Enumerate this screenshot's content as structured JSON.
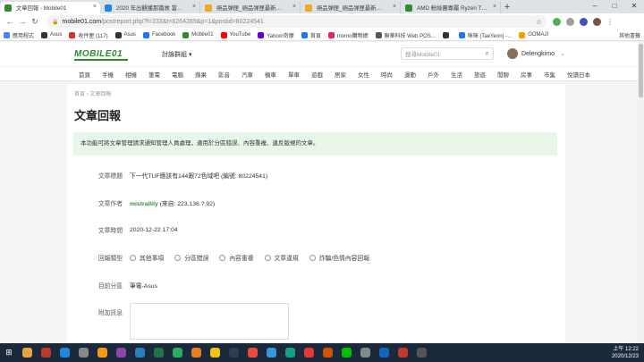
{
  "browser": {
    "tabs": [
      {
        "title": "文章回報 - Mobile01",
        "active": true,
        "color": "#2e8b2e"
      },
      {
        "title": "2020 年出觀播那篇故 當方網站",
        "active": false,
        "color": "#1e88e5"
      },
      {
        "title": "絕品弹匣_絕品弹匣最新電节_发",
        "active": false,
        "color": "#f5a623"
      },
      {
        "title": "絕品弹匣_絕品弹匣最新電节_絕品弹匣小说",
        "active": false,
        "color": "#f5a623"
      },
      {
        "title": "AMD 粉絲團專屬 Ryzen Thread",
        "active": false,
        "color": "#2e8b2e"
      }
    ],
    "url_host": "mobile01.com",
    "url_path": "/postreport.php?f=233&t=6264289&p=1&postid=80224541",
    "bookmarks": [
      {
        "label": "應用程式",
        "color": "#4285f4"
      },
      {
        "label": "Asus",
        "color": "#333"
      },
      {
        "label": "收件匣 (117)",
        "color": "#d93025"
      },
      {
        "label": "Asus",
        "color": "#333"
      },
      {
        "label": "Facebook",
        "color": "#1877f2"
      },
      {
        "label": "Mobile01",
        "color": "#2e8b2e"
      },
      {
        "label": "YouTube",
        "color": "#ff0000"
      },
      {
        "label": "Yahoo!奇摩",
        "color": "#6001d2"
      },
      {
        "label": "首頁",
        "color": "#1877f2"
      },
      {
        "label": "momo購物網",
        "color": "#e91e63"
      },
      {
        "label": "聯華科技 Web POS...",
        "color": "#555"
      },
      {
        "label": "",
        "color": "#333"
      },
      {
        "label": "咪咪 (TaeYeon) -...",
        "color": "#1877f2"
      },
      {
        "label": "GOMAJI",
        "color": "#f59e0b"
      }
    ],
    "other_bookmarks": "其他書籤"
  },
  "site": {
    "logo": "MOBILE01",
    "forum_menu": "討論群組 ▾",
    "search_placeholder": "搜尋Mobile01",
    "username": "Delengkimo",
    "categories": [
      "首頁",
      "手機",
      "相機",
      "筆電",
      "電腦",
      "蘋果",
      "影音",
      "汽車",
      "機車",
      "單車",
      "遊戲",
      "居家",
      "女性",
      "時尚",
      "運動",
      "戶外",
      "生活",
      "旅遊",
      "閒聊",
      "房事",
      "市集",
      "悅讀日本"
    ]
  },
  "page": {
    "breadcrumb": "首頁 › 文章回報",
    "title": "文章回報",
    "notice": "本功能可將文章管理請求通知管理人員處理，適用於分區錯誤、內容重複、違反版規的文章。",
    "fields": {
      "article_title_label": "文章標題",
      "article_title_value": "下一代TUF應該有144跟72色域吧 (編號: 80224541)",
      "author_label": "文章作者",
      "author_name": "mistrallily",
      "author_ip": " (來自: 223.136.?.92)",
      "time_label": "文章時間",
      "time_value": "2020-12-22 17:04",
      "report_type_label": "回報類型",
      "report_options": [
        "其他事項",
        "分區錯誤",
        "內容重複",
        "文章違規",
        "詐騙/色情內容回報"
      ],
      "section_label": "目前分區",
      "section_value": "筆電-Asus",
      "extra_label": "附加訊息"
    }
  },
  "taskbar": {
    "time": "上午 12:22",
    "date": "2020/12/23",
    "apps": [
      "#e8a33c",
      "#c0392b",
      "#1e88e5",
      "#888",
      "#f39c12",
      "#8e44ad",
      "#2980b9",
      "#217346",
      "#27ae60",
      "#e67e22",
      "#f1c40f",
      "#2c3e50",
      "#e74c3c",
      "#3498db",
      "#16a085",
      "#e53935",
      "#d35400",
      "#00c300",
      "#7f8c8d",
      "#1565c0",
      "#c0392b",
      "#555"
    ]
  }
}
